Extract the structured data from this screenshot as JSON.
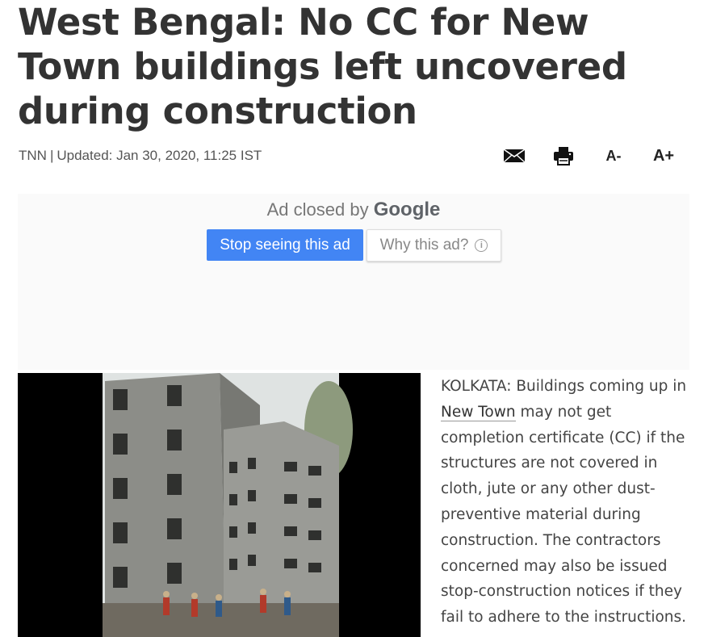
{
  "article": {
    "headline": "West Bengal: No CC for New Town buildings left uncovered during construction",
    "source": "TNN",
    "updated": "Updated: Jan 30, 2020, 11:25 IST",
    "body_before_link": "KOLKATA: Buildings coming up in ",
    "body_link": "New Town",
    "body_after_link": " may not get completion certificate (CC) if the structures are not covered in cloth, jute or any other dust-preventive material during construction. The contractors concerned may also be issued stop-construction notices if they fail to adhere to the instructions."
  },
  "toolbar": {
    "mail_icon": "envelope-icon",
    "print_icon": "printer-icon",
    "font_decrease_label": "A-",
    "font_increase_label": "A+"
  },
  "ad": {
    "closed_by_text": "Ad closed by",
    "google_text": "Google",
    "stop_label": "Stop seeing this ad",
    "why_label": "Why this ad?",
    "info_icon": "info-icon",
    "stop_color": "#4285f4"
  },
  "photo": {
    "subject": "construction-building-photo"
  }
}
